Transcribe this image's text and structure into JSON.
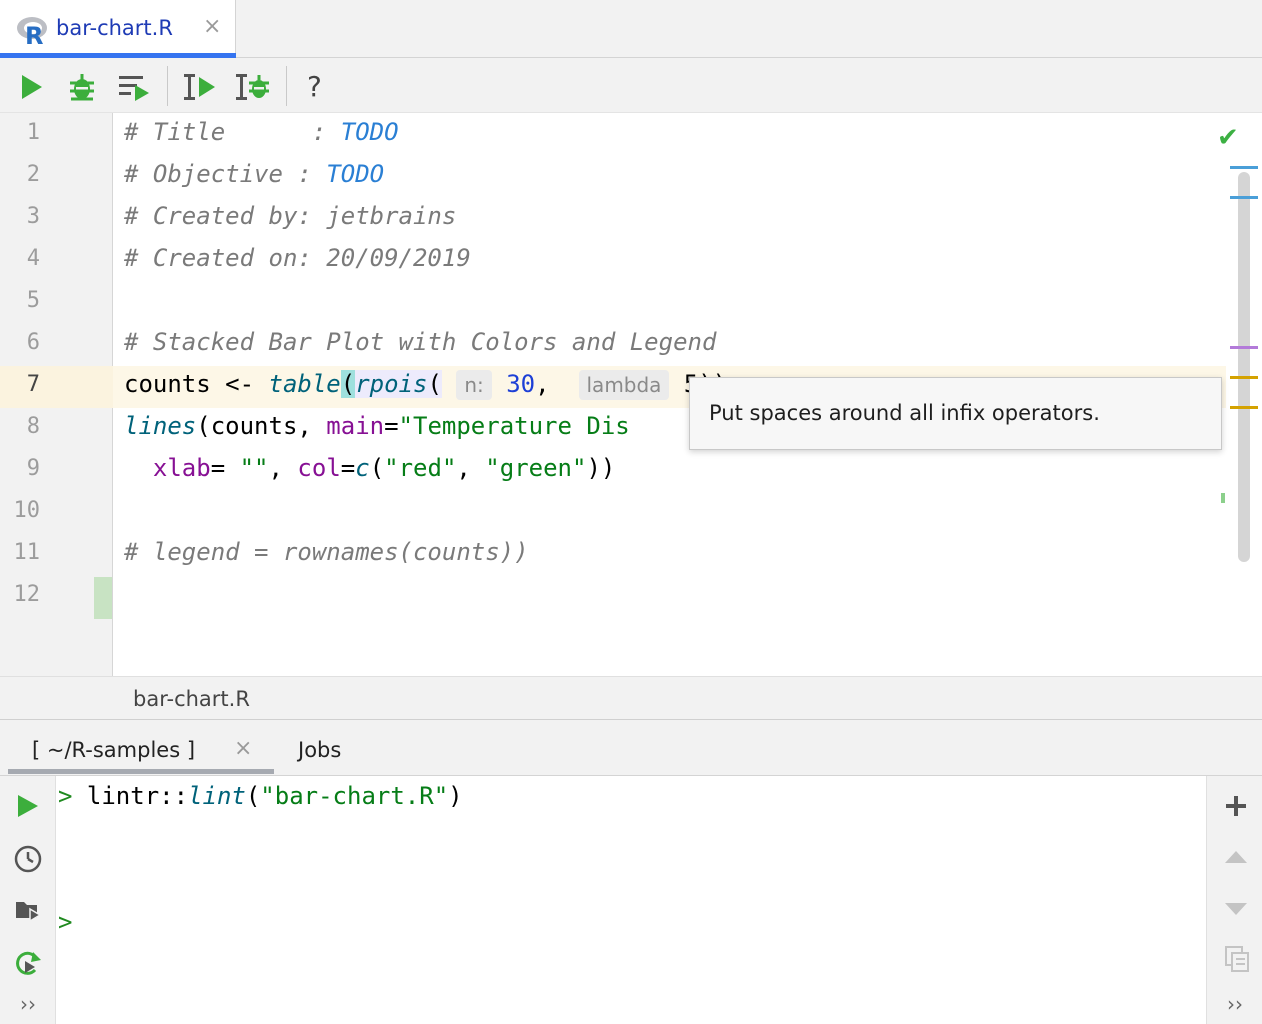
{
  "tab": {
    "title": "bar-chart.R",
    "close": "×",
    "logo_letter": "R"
  },
  "toolbar": {
    "help": "?"
  },
  "editor": {
    "line_numbers": [
      "1",
      "2",
      "3",
      "4",
      "5",
      "6",
      "7",
      "8",
      "9",
      "10",
      "11",
      "12"
    ],
    "line1": {
      "comment": "# Title      : ",
      "todo": "TODO"
    },
    "line2": {
      "comment": "# Objective : ",
      "todo": "TODO"
    },
    "line3": "# Created by: jetbrains",
    "line4": "# Created on: 20/09/2019",
    "line6": "# Stacked Bar Plot with Colors and Legend",
    "line7": {
      "var": "counts",
      "op": " <- ",
      "fn1": "table",
      "open1": "(",
      "fn2": "rpois",
      "open2": "(",
      "hint1": "n:",
      "num1": "30",
      "comma": ",",
      "hint2": "lambda",
      "rest": " 5))"
    },
    "line8": {
      "fn": "lines",
      "open": "(counts, ",
      "param": "main",
      "eq": "=",
      "str": "\"Temperature Dis"
    },
    "line9": {
      "indent": "  ",
      "param1": "xlab",
      "eq1": "= ",
      "str1": "\"\"",
      "sep": ", ",
      "param2": "col",
      "eq2": "=",
      "fn": "c",
      "open": "(",
      "str2": "\"red\"",
      "comma": ", ",
      "str3": "\"green\"",
      "close": "))"
    },
    "line11": "# legend = rownames(counts))"
  },
  "tooltip": {
    "text": "Put spaces around all infix operators."
  },
  "status": {
    "check": "✔"
  },
  "breadcrumb": {
    "text": "bar-chart.R"
  },
  "console": {
    "tabs": [
      {
        "label": "[ ~/R-samples ]",
        "close": "×"
      },
      {
        "label": "Jobs"
      }
    ],
    "line1": {
      "prompt": ">",
      "ns": " lintr::",
      "fn": "lint",
      "open": "(",
      "str": "\"bar-chart.R\"",
      "close": ")"
    },
    "line2": {
      "prompt": ">"
    },
    "left_more": "››",
    "right_more": "››"
  },
  "colors": {
    "accent": "#3574f0",
    "run_green": "#3cae3c",
    "tooltip_bg": "#f7f7f7"
  }
}
